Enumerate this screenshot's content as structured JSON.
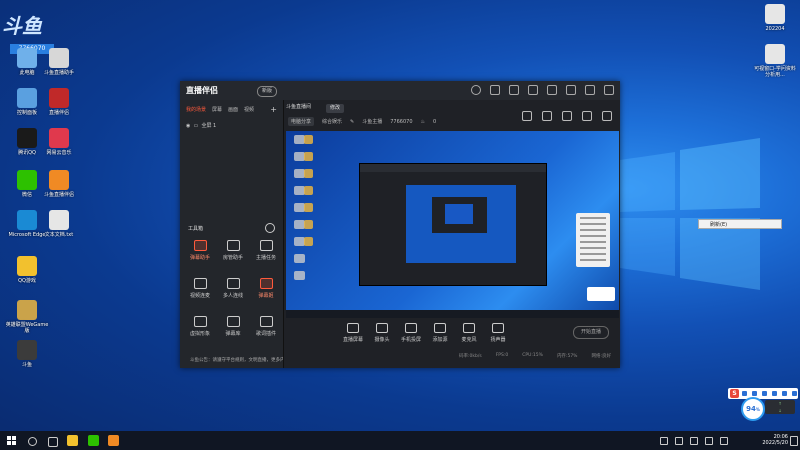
{
  "desktop": {
    "logo_text": "斗鱼",
    "icons_left": [
      {
        "label": "此电脑",
        "color": "#6fb0ea"
      },
      {
        "label": "斗鱼直播助手",
        "color": "#d7d7d7"
      },
      {
        "label": "控制面板",
        "color": "#5aa0e0"
      },
      {
        "label": "直播伴侣",
        "color": "#c02929"
      },
      {
        "label": "腾讯QQ",
        "color": "#1a1a1a"
      },
      {
        "label": "网易云音乐",
        "color": "#e0394d"
      },
      {
        "label": "微信",
        "color": "#2dc100"
      },
      {
        "label": "斗鱼直播伴侣",
        "color": "#f08a24"
      },
      {
        "label": "Microsoft Edge",
        "color": "#1a8ad4"
      },
      {
        "label": "文本文档.txt",
        "color": "#e6e6e6"
      },
      {
        "label": "QQ游戏",
        "color": "#f2c12e"
      },
      {
        "label": "英雄联盟WeGame版",
        "color": "#caa34a"
      },
      {
        "label": "斗鱼",
        "color": "#3b3b3b"
      }
    ],
    "id_box": "7766070",
    "icons_right": [
      {
        "label": "202204",
        "color": "#e6e6e6"
      },
      {
        "label": "可视窗口-学问资料分析用...",
        "color": "#e6e6e6"
      }
    ],
    "context_menu_item": "刷新(E)"
  },
  "app": {
    "title": "直播伴侣",
    "badge": "新版",
    "left_tabs": [
      "我的场景",
      "屏幕",
      "画面",
      "视频"
    ],
    "scene_name": "全屏 1",
    "toolbox_title": "工具箱",
    "tools": [
      {
        "label": "弹幕助手",
        "red": true
      },
      {
        "label": "房管助手",
        "red": false
      },
      {
        "label": "主播任务",
        "red": false
      },
      {
        "label": "视频连麦",
        "red": false
      },
      {
        "label": "多人连线",
        "red": false
      },
      {
        "label": "弹幕姬",
        "red": true
      },
      {
        "label": "虚拟形象",
        "red": false
      },
      {
        "label": "弹幕库",
        "red": false
      },
      {
        "label": "歌词插件",
        "red": false
      }
    ],
    "notice": "斗鱼公告：请遵守平台规则，文明直播，更多内容一键查看",
    "stream_title": "斗鱼直播间",
    "edit_button": "修改",
    "room_pill_label": "电脑分享",
    "room_category": "综合娱乐",
    "room_owner": "斗鱼主播",
    "room_id": "7766070",
    "room_heat": "0",
    "controls": [
      "直播屏幕",
      "摄像头",
      "手机投屏",
      "添加源",
      "麦克风",
      "扬声器"
    ],
    "start_button": "开始直播",
    "status": [
      "码率:0kb/s",
      "FPS:0",
      "CPU:15%",
      "内存:57%",
      "网络:良好"
    ]
  },
  "tray": {
    "time": "20:06",
    "date": "2022/5/20",
    "ime_label": "S",
    "gauge_value": "94",
    "gauge_unit": "%"
  }
}
